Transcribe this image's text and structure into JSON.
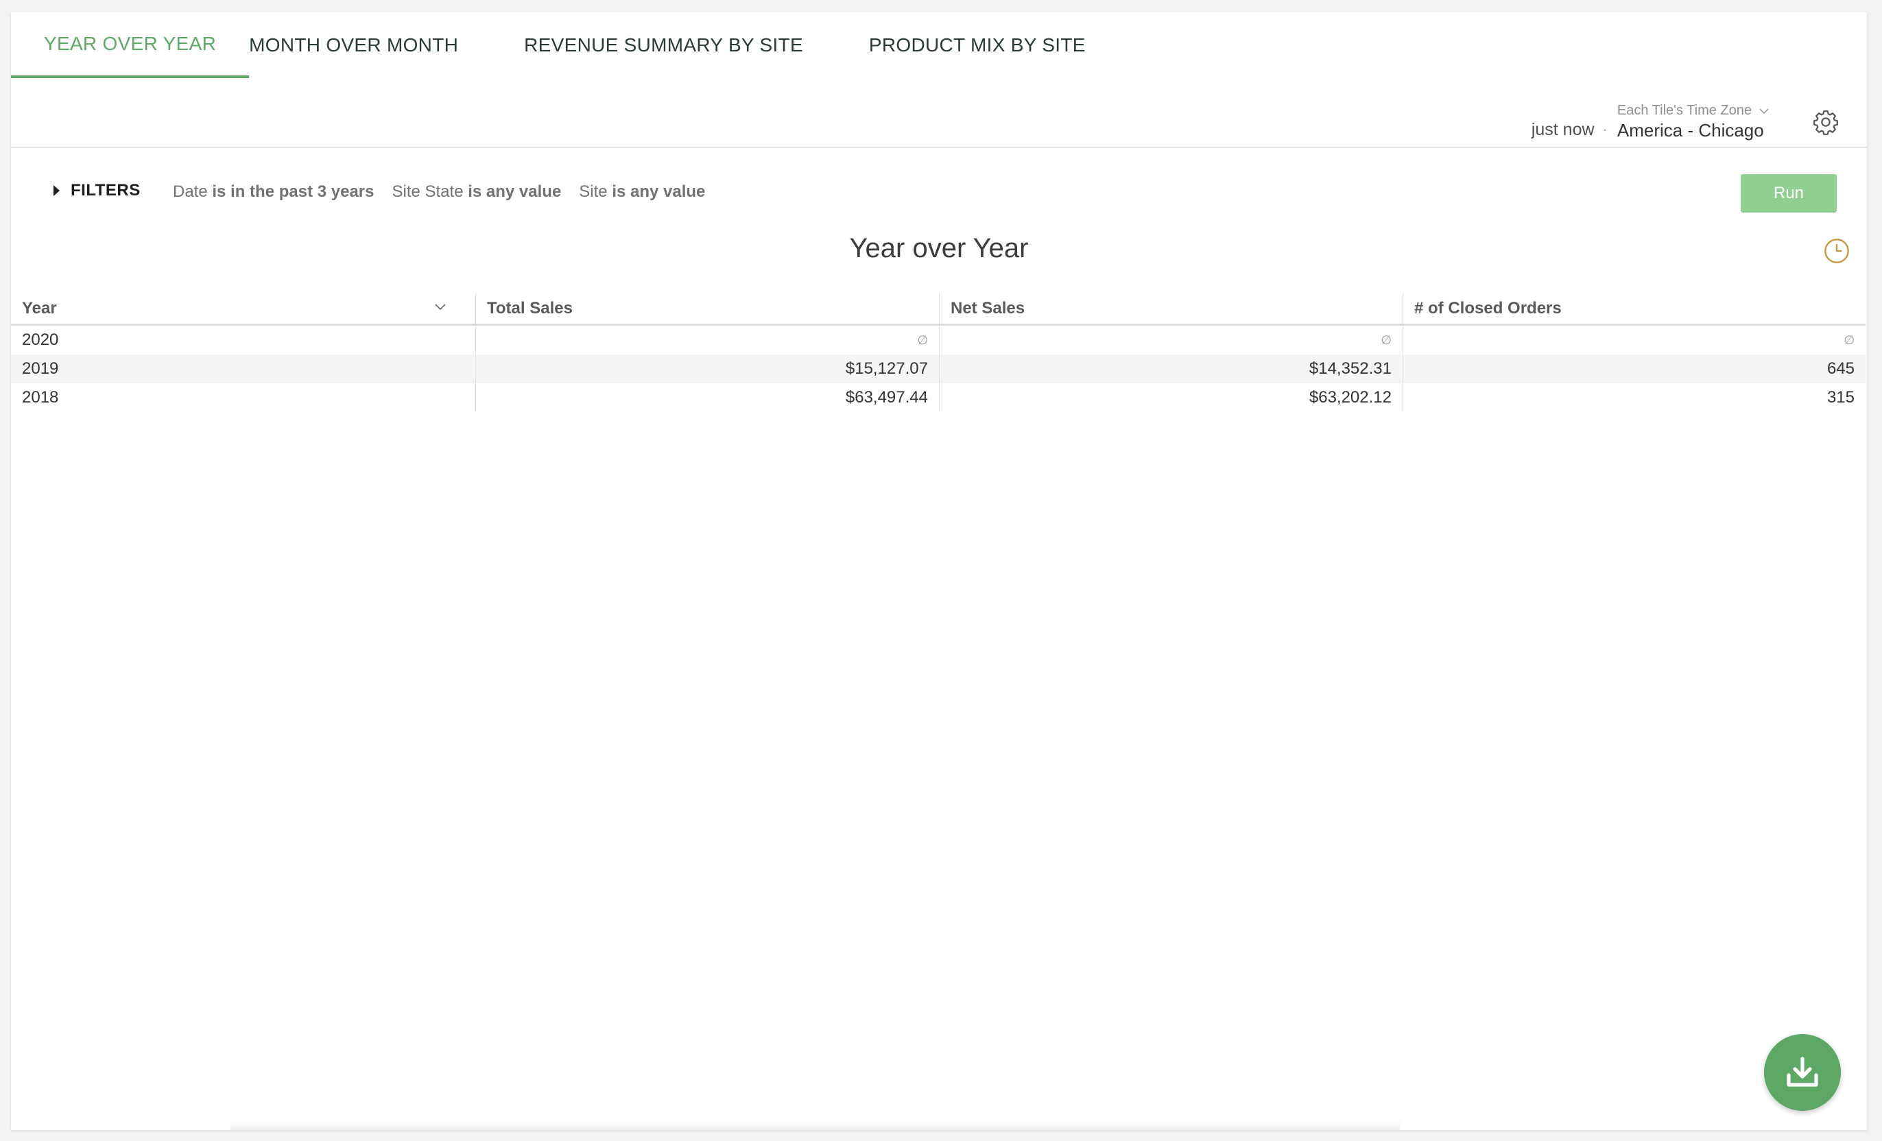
{
  "tabs": [
    {
      "label": "YEAR OVER YEAR",
      "active": true
    },
    {
      "label": "MONTH OVER MONTH",
      "active": false
    },
    {
      "label": "REVENUE SUMMARY BY SITE",
      "active": false
    },
    {
      "label": "PRODUCT MIX BY SITE",
      "active": false
    }
  ],
  "header": {
    "updated": "just now",
    "separator": "·",
    "timezone_label": "Each Tile's Time Zone",
    "timezone_value": "America - Chicago"
  },
  "filters": {
    "label": "FILTERS",
    "items": [
      {
        "field": "Date",
        "condition": "is in the past 3 years"
      },
      {
        "field": "Site State",
        "condition": "is any value"
      },
      {
        "field": "Site",
        "condition": "is any value"
      }
    ],
    "run_label": "Run"
  },
  "tile": {
    "title": "Year over Year"
  },
  "table": {
    "headers": [
      "Year",
      "Total Sales",
      "Net Sales",
      "# of Closed Orders"
    ],
    "null_glyph": "∅",
    "rows": [
      [
        "2020",
        "∅",
        "∅",
        "∅"
      ],
      [
        "2019",
        "$15,127.07",
        "$14,352.31",
        "645"
      ],
      [
        "2018",
        "$63,497.44",
        "$63,202.12",
        "315"
      ]
    ]
  },
  "colors": {
    "accent": "#5fa865",
    "run_button": "#8fcf92",
    "fab": "#5ea866",
    "clock_icon": "#c8953a"
  },
  "icons": {
    "settings": "gear-icon",
    "refresh_info": "clock-icon",
    "download": "download-icon"
  }
}
